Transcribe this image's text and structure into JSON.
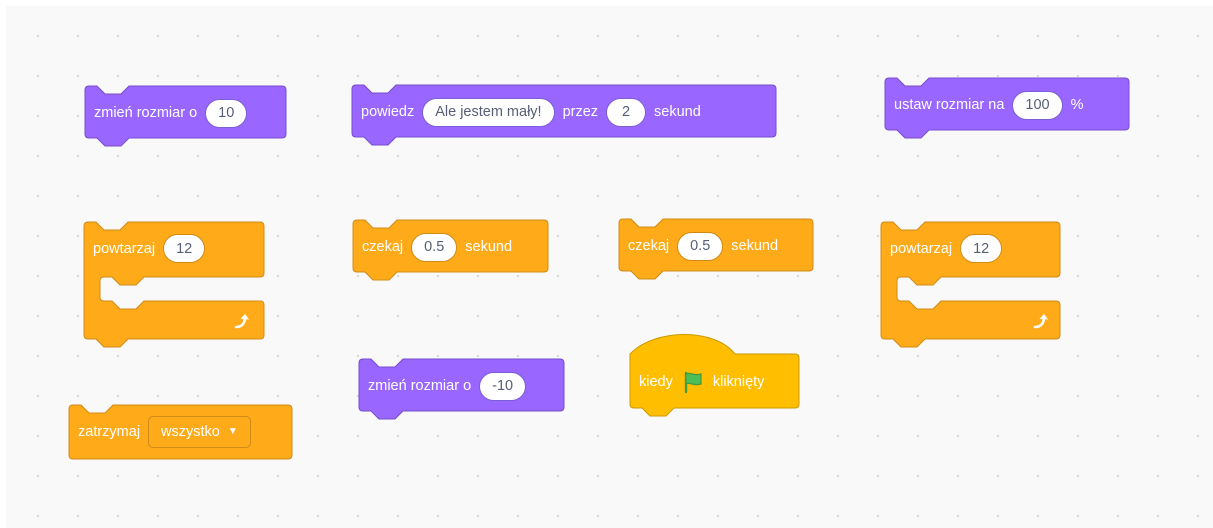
{
  "colors": {
    "looks": "#9966ff",
    "looks_border": "#774dcb",
    "control": "#ffab19",
    "control_border": "#cf8b17",
    "events": "#ffbf00",
    "events_border": "#cc9900",
    "input_text": "#575e75",
    "flag": "#4cbf56"
  },
  "blocks": {
    "change_size_1": {
      "label": "zmień rozmiar o",
      "value": "10"
    },
    "say": {
      "label_say": "powiedz",
      "message": "Ale jestem mały!",
      "label_for": "przez",
      "seconds": "2",
      "label_seconds": "sekund"
    },
    "set_size": {
      "label": "ustaw rozmiar na",
      "value": "100",
      "unit": "%"
    },
    "repeat_1": {
      "label": "powtarzaj",
      "value": "12",
      "loop_icon": "loop-arrow-icon"
    },
    "wait_1": {
      "label": "czekaj",
      "value": "0.5",
      "unit": "sekund"
    },
    "wait_2": {
      "label": "czekaj",
      "value": "0.5",
      "unit": "sekund"
    },
    "repeat_2": {
      "label": "powtarzaj",
      "value": "12",
      "loop_icon": "loop-arrow-icon"
    },
    "change_size_2": {
      "label": "zmień rozmiar o",
      "value": "-10"
    },
    "when_flag": {
      "label_when": "kiedy",
      "icon": "green-flag-icon",
      "label_clicked": "kliknięty"
    },
    "stop": {
      "label": "zatrzymaj",
      "option": "wszystko"
    }
  }
}
